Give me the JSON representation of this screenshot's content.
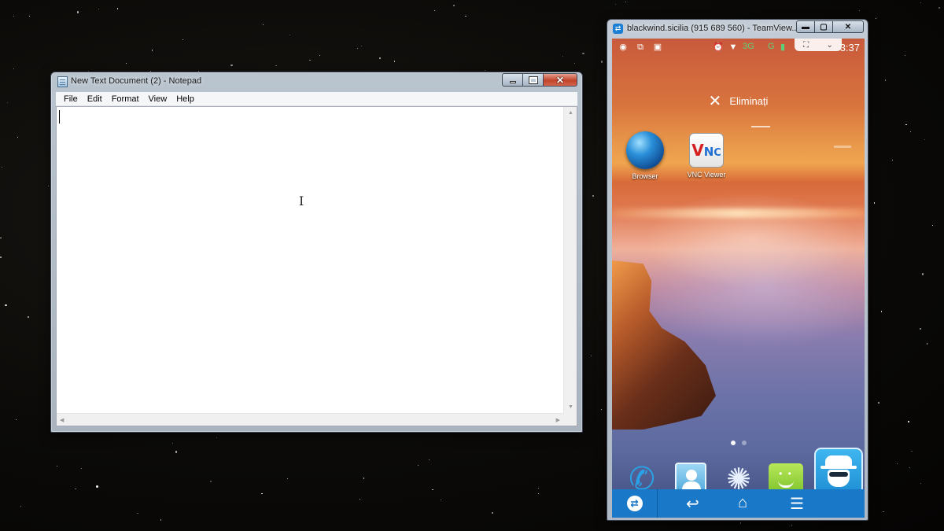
{
  "notepad": {
    "title": "New Text Document (2) - Notepad",
    "menus": [
      "File",
      "Edit",
      "Format",
      "View",
      "Help"
    ],
    "content": ""
  },
  "teamviewer": {
    "title": "blackwind.sicilia (915 689 560) - TeamView...",
    "phone": {
      "status_time": "3:37",
      "network_3g": "3G",
      "network_g": "G",
      "remove_label": "Eliminați",
      "apps": [
        {
          "label": "Browser",
          "icon": "globe-icon"
        },
        {
          "label": "VNC Viewer",
          "icon": "vnc-icon",
          "glyph_v": "V",
          "glyph_n": "N",
          "glyph_c": "C"
        }
      ],
      "dock": [
        "phone-icon",
        "contacts-icon",
        "turtle-icon",
        "messaging-icon",
        "spy-app-icon"
      ],
      "nav": [
        "teamviewer-icon",
        "back-icon",
        "home-icon",
        "recents-icon"
      ]
    }
  },
  "colors": {
    "nav_bar": "#1a78c8",
    "close_button": "#c2442c"
  }
}
